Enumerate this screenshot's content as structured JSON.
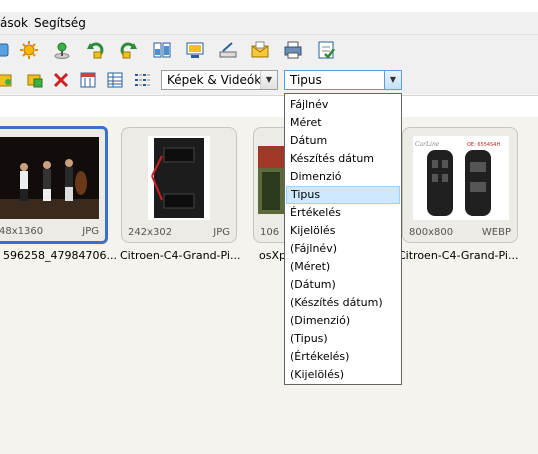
{
  "menu": {
    "items": [
      "ások",
      "Segítség"
    ]
  },
  "toolbar2": {
    "media_filter": "Képek & Videók",
    "sort_by": "Tipus"
  },
  "sort_dropdown": {
    "options": [
      "Fájlnév",
      "Méret",
      "Dátum",
      "Készítés dátum",
      "Dimenzió",
      "Tipus",
      "Értékelés",
      "Kijelölés",
      "(Fájlnév)",
      "(Méret)",
      "(Dátum)",
      "(Készítés dátum)",
      "(Dimenzió)",
      "(Tipus)",
      "(Értékelés)",
      "(Kijelölés)"
    ],
    "highlighted": "Tipus"
  },
  "thumbnails": [
    {
      "dims": "48x1360",
      "type": "JPG",
      "caption": "596258_47984706...",
      "selected": true
    },
    {
      "dims": "242x302",
      "type": "JPG",
      "caption": "Citroen-C4-Grand-Pi...",
      "selected": false
    },
    {
      "dims": "106",
      "type": "",
      "caption": "osXp",
      "selected": false
    },
    {
      "dims": "800x800",
      "type": "WEBP",
      "caption": "Citroen-C4-Grand-Pi...",
      "selected": false
    }
  ],
  "thumb4_brand": "CarLine",
  "thumb4_code": "OE: 6554S4H",
  "colors": {
    "selection": "#3a73c6",
    "highlight": "#cde8ff",
    "dropdown_focus": "#569de5"
  }
}
